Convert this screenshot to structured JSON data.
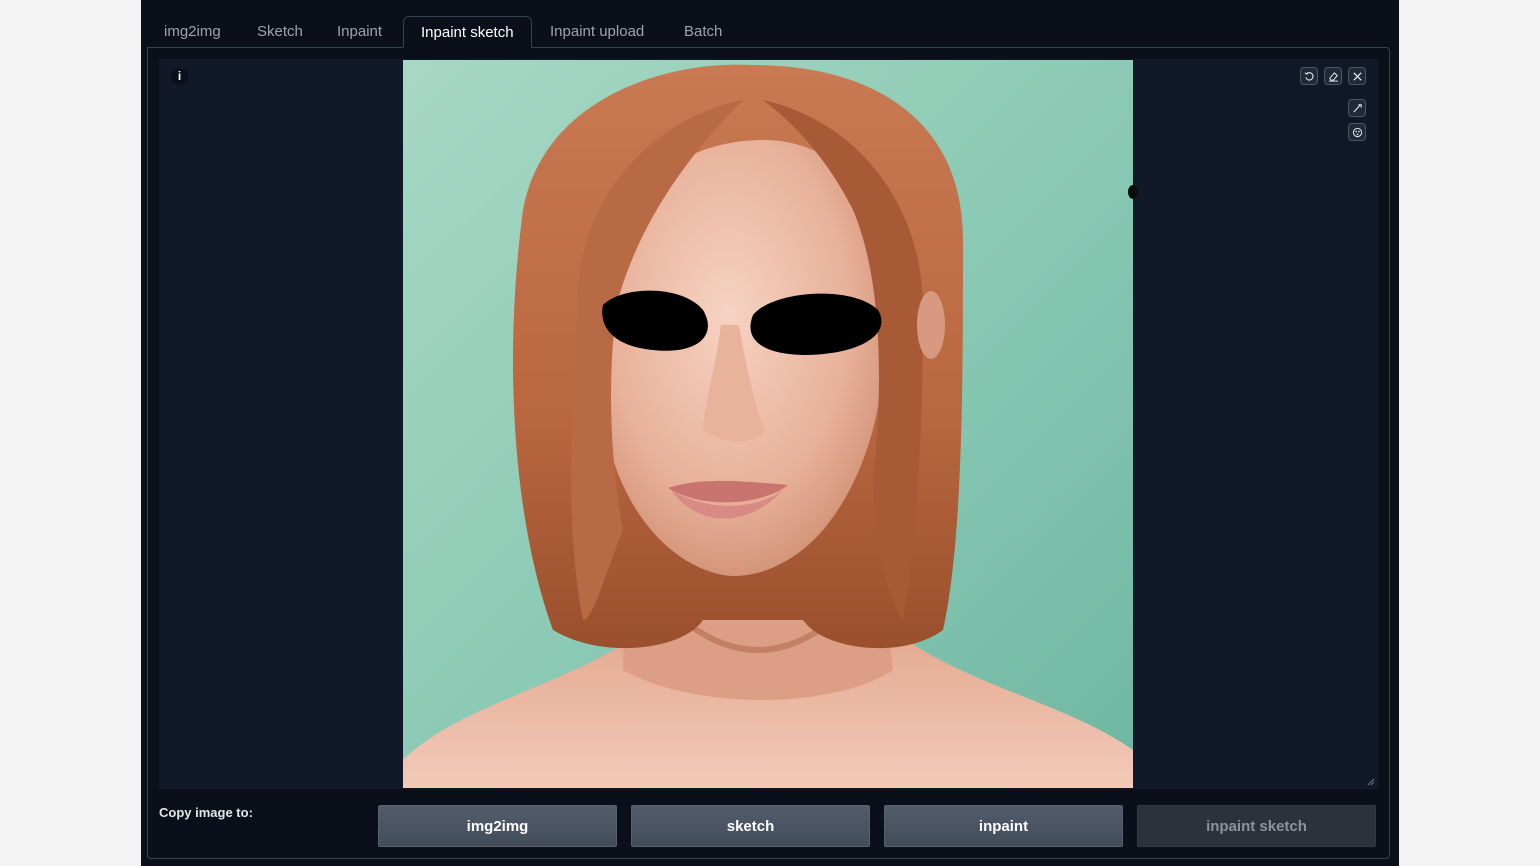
{
  "tabs": [
    {
      "label": "img2img",
      "selected": false
    },
    {
      "label": "Sketch",
      "selected": false
    },
    {
      "label": "Inpaint",
      "selected": false
    },
    {
      "label": "Inpaint sketch",
      "selected": true
    },
    {
      "label": "Inpaint upload",
      "selected": false
    },
    {
      "label": "Batch",
      "selected": false
    }
  ],
  "editor": {
    "info_glyph": "i",
    "image": "portrait of woman with shoulder-length auburn bob hair, eyes covered by two black sketched mask ovals, teal background",
    "toolbar": [
      {
        "icon": "undo-icon"
      },
      {
        "icon": "eraser-icon"
      },
      {
        "icon": "close-icon"
      },
      {
        "icon": "brush-icon"
      },
      {
        "icon": "color-palette-icon"
      }
    ]
  },
  "copy": {
    "label": "Copy image to:",
    "buttons": [
      {
        "label": "img2img",
        "enabled": true
      },
      {
        "label": "sketch",
        "enabled": true
      },
      {
        "label": "inpaint",
        "enabled": true
      },
      {
        "label": "inpaint sketch",
        "enabled": false
      }
    ]
  },
  "colors": {
    "background": "#0b0f19",
    "editor_bg": "#111827",
    "border": "#374151",
    "button": "#4b5563"
  }
}
